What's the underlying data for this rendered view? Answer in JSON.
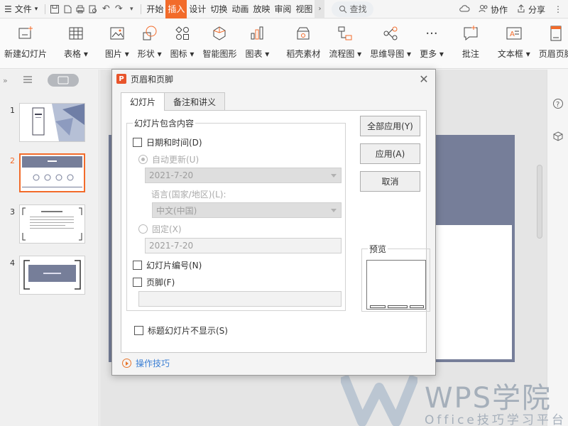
{
  "menubar": {
    "file": "文件",
    "tabs": [
      "开始",
      "插入",
      "设计",
      "切换",
      "动画",
      "放映",
      "审阅",
      "视图"
    ],
    "active_tab_index": 1,
    "search": "查找",
    "collab": "协作",
    "share": "分享"
  },
  "ribbon": {
    "items": [
      "新建幻灯片",
      "表格",
      "图片",
      "形状",
      "图标",
      "智能图形",
      "图表",
      "稻壳素材",
      "流程图",
      "思维导图",
      "更多",
      "批注",
      "文本框",
      "页眉页脚"
    ]
  },
  "slides": [
    "1",
    "2",
    "3",
    "4"
  ],
  "selected_slide": "2",
  "dialog": {
    "title": "页眉和页脚",
    "tabs": [
      "幻灯片",
      "备注和讲义"
    ],
    "group_label": "幻灯片包含内容",
    "date_time": "日期和时间(D)",
    "auto_update": "自动更新(U)",
    "date_value": "2021-7-20",
    "language_label": "语言(国家/地区)(L):",
    "language_value": "中文(中国)",
    "fixed": "固定(X)",
    "fixed_value": "2021-7-20",
    "slide_number": "幻灯片编号(N)",
    "footer": "页脚(F)",
    "footer_value": "",
    "hide_title": "标题幻灯片不显示(S)",
    "apply_all": "全部应用(Y)",
    "apply": "应用(A)",
    "cancel": "取消",
    "preview": "预览",
    "tips": "操作技巧"
  },
  "watermark": {
    "title": "WPS学院",
    "subtitle": "Office技巧学习平台"
  },
  "colors": {
    "accent": "#f26b2a",
    "slide_theme": "#767e99",
    "link": "#3b7fd4"
  }
}
